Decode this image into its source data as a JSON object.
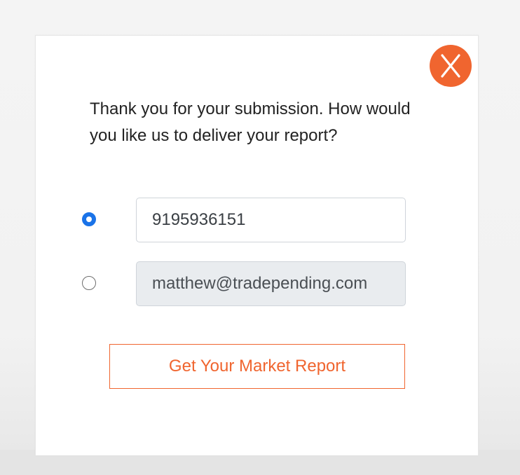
{
  "modal": {
    "message": "Thank you for your submission. How would you like us to deliver your report?",
    "close_icon": "close-x-icon",
    "accent_color": "#f0652f",
    "radio_color": "#1a73e8"
  },
  "delivery_options": {
    "phone": {
      "value": "9195936151",
      "selected": true
    },
    "email": {
      "value": "matthew@tradepending.com",
      "selected": false,
      "disabled": true
    }
  },
  "submit": {
    "label": "Get Your Market Report"
  }
}
